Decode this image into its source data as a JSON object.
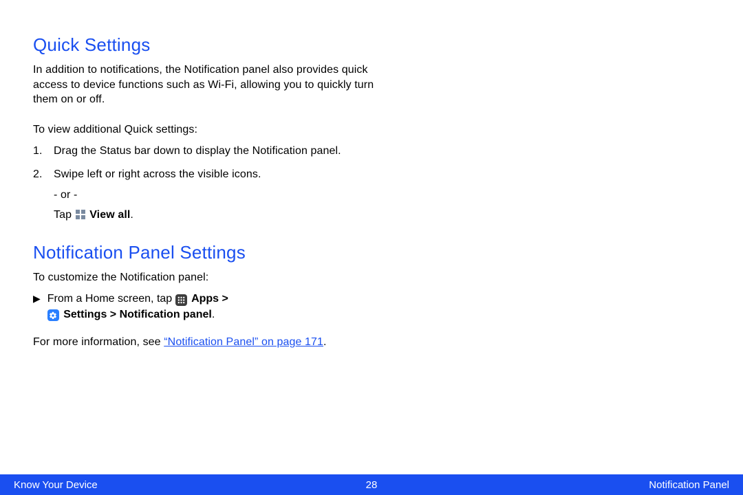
{
  "section1": {
    "heading": "Quick Settings",
    "intro": "In addition to notifications, the Notification panel also provides quick access to device functions such as Wi-Fi, allowing you to quickly turn them on or off.",
    "lead": "To view additional Quick settings:",
    "steps": [
      {
        "num": "1.",
        "text": "Drag the Status bar down to display the Notification panel."
      },
      {
        "num": "2.",
        "text": "Swipe left or right across the visible icons."
      }
    ],
    "or": "- or -",
    "tap_prefix": "Tap ",
    "view_all": "View all",
    "period": "."
  },
  "section2": {
    "heading": "Notification Panel Settings",
    "lead": "To customize the Notification panel:",
    "from_home": "From a Home screen, tap ",
    "apps": "Apps",
    "gt": " > ",
    "settings": "Settings",
    "np_path": " > Notification panel",
    "period": ".",
    "ref_prefix": " For more information, see ",
    "ref_link": "“Notification Panel” on page 171",
    "ref_suffix": "."
  },
  "footer": {
    "left": "Know Your Device",
    "center": "28",
    "right": "Notification Panel"
  }
}
